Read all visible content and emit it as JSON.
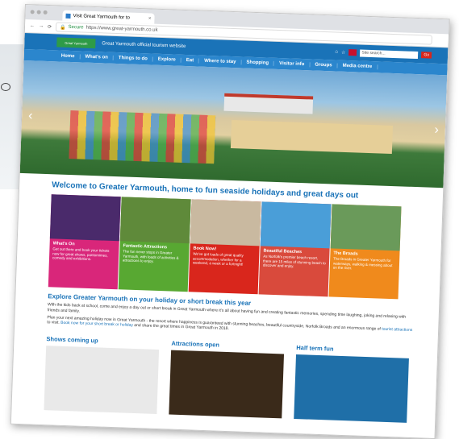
{
  "browser": {
    "tab_title": "Visit Great Yarmouth for to",
    "tab_close": "×",
    "secure_label": "Secure",
    "url": "https://www.great-yarmouth.co.uk"
  },
  "header": {
    "logo_text": "Great Yarmouth",
    "tagline": "Great Yarmouth official tourism website",
    "search_placeholder": "Site search...",
    "go_label": "Go"
  },
  "nav": {
    "items": [
      "Home",
      "What's on",
      "Things to do",
      "Explore",
      "Eat",
      "Where to stay",
      "Shopping",
      "Visitor info",
      "Groups",
      "Media centre"
    ]
  },
  "welcome": "Welcome to Greater Yarmouth, home to fun seaside holidays and great days out",
  "tiles": [
    {
      "label": "What's On",
      "desc": "Get out there and book your tickets now for great shows, pantomimes, comedy and exhibitions.",
      "color": "#d9267a",
      "img": "#4a2a6b"
    },
    {
      "label": "Fantastic Attractions",
      "desc": "The fun never stops in Greater Yarmouth, with loads of activities & attractions to enjoy.",
      "color": "#58a832",
      "img": "#5f8a3a"
    },
    {
      "label": "Book Now!",
      "desc": "We've got loads of great quality accommodation, whether for a weekend, a week or a fortnight!",
      "color": "#d9261c",
      "img": "#c9b9a0"
    },
    {
      "label": "Beautiful Beaches",
      "desc": "As Norfolk's premier beach resort, there are 15 miles of stunning beach to discover and enjoy.",
      "color": "#d94a3c",
      "img": "#4a9ed8"
    },
    {
      "label": "The Broads",
      "desc": "The Broads in Greater Yarmouth for waterways, walking & messing about on the river.",
      "color": "#f08a1c",
      "img": "#6a9a5a"
    }
  ],
  "explore": {
    "title": "Explore Greater Yarmouth on your holiday or short break this year",
    "p1": "With the kids back at school, come and enjoy a day out or short break in Great Yarmouth where it's all about having fun and creating fantastic memories, spending time laughing, joking and relaxing with friends and family.",
    "p2_start": "Plan your next amazing holiday now in Great Yarmouth - the resort where happiness is guaranteed with stunning beaches, beautiful countryside, Norfolk Broads and an enormous range of ",
    "p2_link1": "tourist attractions",
    "p2_mid": " to visit. ",
    "p2_link2": "Book now for your short break or holiday",
    "p2_end": " and share the great times in Great Yarmouth in 2018."
  },
  "columns": [
    {
      "title": "Shows coming up",
      "img": "#e9e9e9"
    },
    {
      "title": "Attractions open",
      "img": "#3a2a1a"
    },
    {
      "title": "Half term fun",
      "img": "#1f6fa8"
    }
  ]
}
